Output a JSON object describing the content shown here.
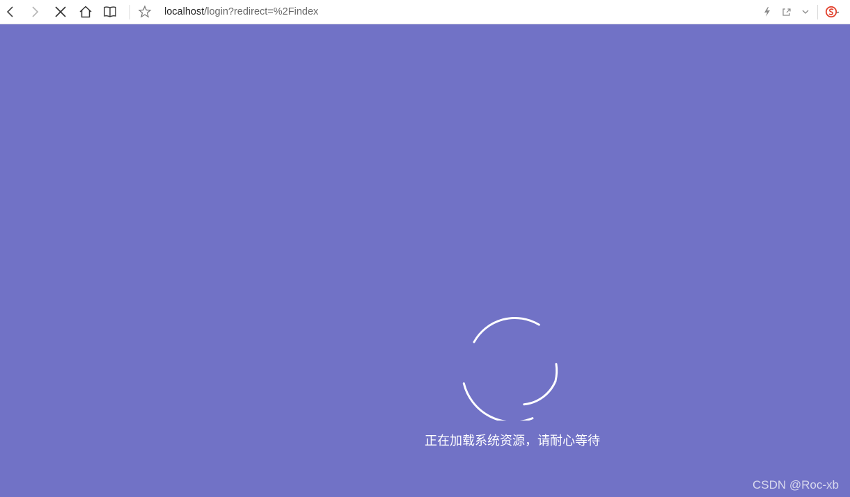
{
  "browser": {
    "address_host": "localhost",
    "address_path": "/login?redirect=%2Findex",
    "icons": {
      "back": "back-arrow-icon",
      "forward": "forward-arrow-icon",
      "stop": "stop-close-icon",
      "home": "home-icon",
      "reading": "reading-mode-icon",
      "favorite": "star-icon",
      "lightning": "lightning-icon",
      "share": "share-icon",
      "dropdown": "chevron-down-icon",
      "extension": "sogou-s-icon"
    }
  },
  "page": {
    "background_color": "#7172c6",
    "loading_text": "正在加载系统资源，请耐心等待",
    "watermark": "CSDN @Roc-xb"
  }
}
